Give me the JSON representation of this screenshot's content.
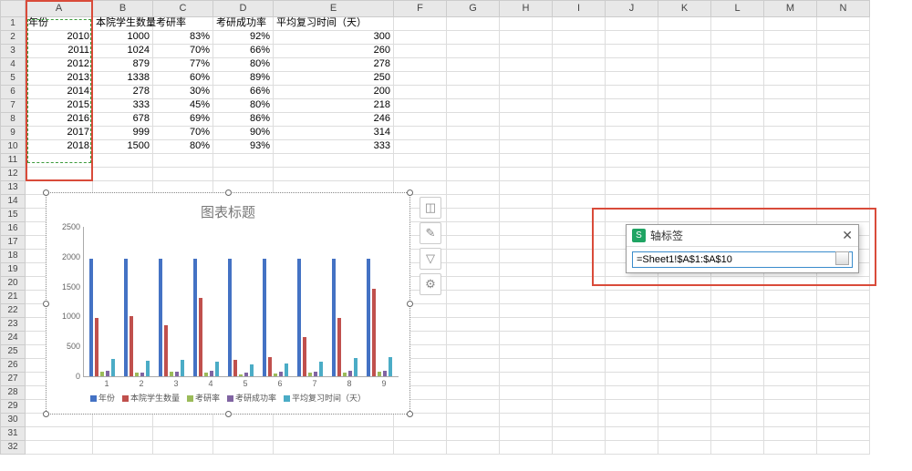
{
  "columns": [
    "A",
    "B",
    "C",
    "D",
    "E",
    "F",
    "G",
    "H",
    "I",
    "J",
    "K",
    "L",
    "M",
    "N"
  ],
  "rows": 32,
  "headers": {
    "A": "年份",
    "B": "本院学生数量",
    "C": "考研率",
    "D": "考研成功率",
    "E": "平均复习时间（天）"
  },
  "table": [
    {
      "A": "2010",
      "B": "1000",
      "C": "83%",
      "D": "92%",
      "E": "300"
    },
    {
      "A": "2011",
      "B": "1024",
      "C": "70%",
      "D": "66%",
      "E": "260"
    },
    {
      "A": "2012",
      "B": "879",
      "C": "77%",
      "D": "80%",
      "E": "278"
    },
    {
      "A": "2013",
      "B": "1338",
      "C": "60%",
      "D": "89%",
      "E": "250"
    },
    {
      "A": "2014",
      "B": "278",
      "C": "30%",
      "D": "66%",
      "E": "200"
    },
    {
      "A": "2015",
      "B": "333",
      "C": "45%",
      "D": "80%",
      "E": "218"
    },
    {
      "A": "2016",
      "B": "678",
      "C": "69%",
      "D": "86%",
      "E": "246"
    },
    {
      "A": "2017",
      "B": "999",
      "C": "70%",
      "D": "90%",
      "E": "314"
    },
    {
      "A": "2018",
      "B": "1500",
      "C": "80%",
      "D": "93%",
      "E": "333"
    }
  ],
  "chart": {
    "title": "图表标题",
    "legend": [
      "年份",
      "本院学生数量",
      "考研率",
      "考研成功率",
      "平均复习时间（天）"
    ],
    "colors": [
      "#4472c4",
      "#c0504d",
      "#9bbb59",
      "#8064a2",
      "#4bacc6"
    ],
    "yticks": [
      "0",
      "500",
      "1000",
      "1500",
      "2000",
      "2500"
    ],
    "xcats": [
      "1",
      "2",
      "3",
      "4",
      "5",
      "6",
      "7",
      "8",
      "9"
    ]
  },
  "chart_data": {
    "type": "bar",
    "title": "图表标题",
    "categories": [
      1,
      2,
      3,
      4,
      5,
      6,
      7,
      8,
      9
    ],
    "series": [
      {
        "name": "年份",
        "values": [
          2010,
          2011,
          2012,
          2013,
          2014,
          2015,
          2016,
          2017,
          2018
        ]
      },
      {
        "name": "本院学生数量",
        "values": [
          1000,
          1024,
          879,
          1338,
          278,
          333,
          678,
          999,
          1500
        ]
      },
      {
        "name": "考研率",
        "values": [
          83,
          70,
          77,
          60,
          30,
          45,
          69,
          70,
          80
        ]
      },
      {
        "name": "考研成功率",
        "values": [
          92,
          66,
          80,
          89,
          66,
          80,
          86,
          90,
          93
        ]
      },
      {
        "name": "平均复习时间（天）",
        "values": [
          300,
          260,
          278,
          250,
          200,
          218,
          246,
          314,
          333
        ]
      }
    ],
    "ylim": [
      0,
      2500
    ],
    "xlabel": "",
    "ylabel": ""
  },
  "popup": {
    "title": "轴标签",
    "value": "=Sheet1!$A$1:$A$10"
  }
}
